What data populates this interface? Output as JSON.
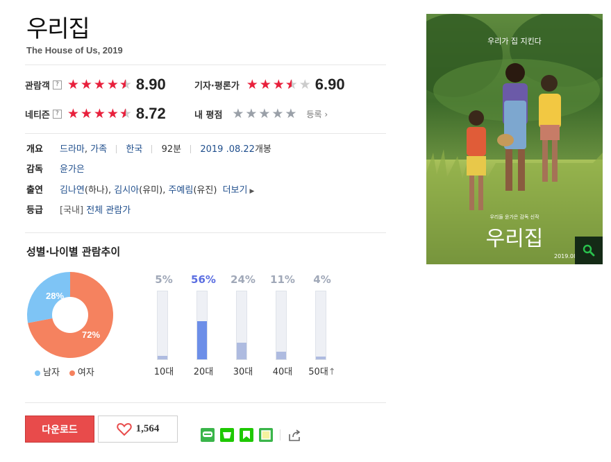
{
  "movie": {
    "title": "우리집",
    "subtitle": "The House of Us, 2019"
  },
  "ratings": {
    "audience": {
      "label": "관람객",
      "help": "?",
      "score": "8.90",
      "stars": 4.5
    },
    "critic": {
      "label": "기자·평론가",
      "score": "6.90",
      "stars": 3.5
    },
    "netizen": {
      "label": "네티즌",
      "help": "?",
      "score": "8.72",
      "stars": 4.5
    },
    "mine": {
      "label": "내 평점",
      "enroll": "등록",
      "stars": 0
    }
  },
  "info": {
    "overview": {
      "key": "개요",
      "genre1": "드라마",
      "genre2": "가족",
      "country": "한국",
      "runtime": "92분",
      "release_date": "2019 .08.22",
      "release_suffix": "개봉"
    },
    "director": {
      "key": "감독",
      "name": "윤가은"
    },
    "cast": {
      "key": "출연",
      "actor1": "김나연",
      "role1": "(하나)",
      "actor2": "김시아",
      "role2": "(유미)",
      "actor3": "주예림",
      "role3": "(유진)",
      "more": "더보기"
    },
    "grade": {
      "key": "등급",
      "prefix": "[국내]",
      "value": "전체 관람가"
    }
  },
  "audience_trend": {
    "title": "성별·나이별 관람추이",
    "gender": {
      "male": {
        "label": "남자",
        "percent": 28,
        "text": "28%",
        "color": "#7ec4f5"
      },
      "female": {
        "label": "여자",
        "percent": 72,
        "text": "72%",
        "color": "#f5825f"
      }
    },
    "ages": [
      {
        "label": "10대",
        "percent": 5,
        "text": "5%"
      },
      {
        "label": "20대",
        "percent": 56,
        "text": "56%"
      },
      {
        "label": "30대",
        "percent": 24,
        "text": "24%"
      },
      {
        "label": "40대",
        "percent": 11,
        "text": "11%"
      },
      {
        "label": "50대",
        "percent": 4,
        "text": "4%",
        "suffix": "↑"
      }
    ]
  },
  "actions": {
    "download": "다운로드",
    "likes": "1,564"
  },
  "poster": {
    "top_text": "우리가 집 지킨다",
    "credit_text": "우리들 윤가은 감독 신작",
    "title": "우리집",
    "date": "2019.08"
  },
  "colors": {
    "star_red": "#e8203c",
    "link_blue": "#1f4e8c",
    "download_red": "#e84b4b",
    "age_highlight": "#5b6ee1"
  }
}
